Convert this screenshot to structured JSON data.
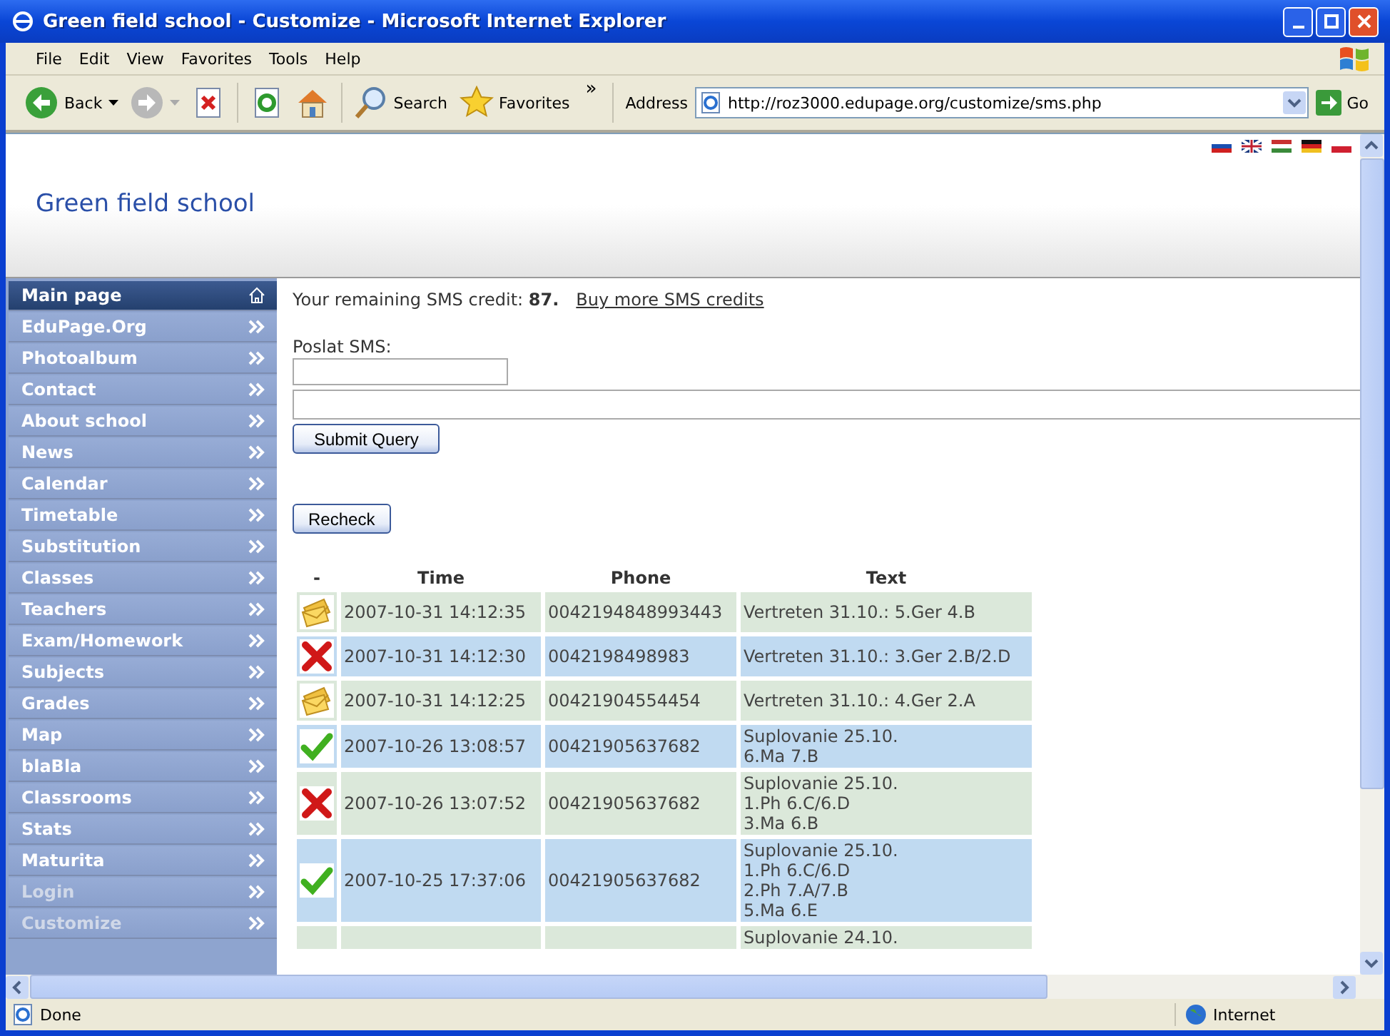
{
  "window": {
    "title": "Green field school - Customize - Microsoft Internet Explorer"
  },
  "menu_bar": [
    "File",
    "Edit",
    "View",
    "Favorites",
    "Tools",
    "Help"
  ],
  "toolbar": [
    {
      "kind": "back",
      "label": "Back"
    },
    {
      "kind": "forward"
    },
    {
      "kind": "stop"
    },
    {
      "kind": "refresh"
    },
    {
      "kind": "home"
    },
    {
      "kind": "search",
      "label": "Search"
    },
    {
      "kind": "favorites",
      "label": "Favorites"
    }
  ],
  "overflow": "»",
  "address": {
    "label": "Address",
    "value": "http://roz3000.edupage.org/customize/sms.php",
    "go": "Go"
  },
  "site": {
    "title": "Green field school"
  },
  "sidebar": {
    "items": [
      {
        "label": "Main page",
        "kind": "home",
        "selected": true,
        "disabled": false
      },
      {
        "label": "EduPage.Org",
        "kind": "link",
        "selected": false,
        "disabled": false
      },
      {
        "label": "Photoalbum",
        "kind": "link",
        "selected": false,
        "disabled": false
      },
      {
        "label": "Contact",
        "kind": "link",
        "selected": false,
        "disabled": false
      },
      {
        "label": "About school",
        "kind": "link",
        "selected": false,
        "disabled": false
      },
      {
        "label": "News",
        "kind": "link",
        "selected": false,
        "disabled": false
      },
      {
        "label": "Calendar",
        "kind": "link",
        "selected": false,
        "disabled": false
      },
      {
        "label": "Timetable",
        "kind": "link",
        "selected": false,
        "disabled": false
      },
      {
        "label": "Substitution",
        "kind": "link",
        "selected": false,
        "disabled": false
      },
      {
        "label": "Classes",
        "kind": "link",
        "selected": false,
        "disabled": false
      },
      {
        "label": "Teachers",
        "kind": "link",
        "selected": false,
        "disabled": false
      },
      {
        "label": "Exam/Homework",
        "kind": "link",
        "selected": false,
        "disabled": false
      },
      {
        "label": "Subjects",
        "kind": "link",
        "selected": false,
        "disabled": false
      },
      {
        "label": "Grades",
        "kind": "link",
        "selected": false,
        "disabled": false
      },
      {
        "label": "Map",
        "kind": "link",
        "selected": false,
        "disabled": false
      },
      {
        "label": "blaBla",
        "kind": "link",
        "selected": false,
        "disabled": false
      },
      {
        "label": "Classrooms",
        "kind": "link",
        "selected": false,
        "disabled": false
      },
      {
        "label": "Stats",
        "kind": "link",
        "selected": false,
        "disabled": false
      },
      {
        "label": "Maturita",
        "kind": "link",
        "selected": false,
        "disabled": false
      },
      {
        "label": "Login",
        "kind": "link",
        "selected": false,
        "disabled": true
      },
      {
        "label": "Customize",
        "kind": "link",
        "selected": false,
        "disabled": true
      }
    ]
  },
  "credit": {
    "text": "Your remaining SMS credit: **87.**",
    "link": "Buy more SMS credits"
  },
  "form": {
    "label": "Poslat SMS:",
    "submit": "Submit Query",
    "recheck": "Recheck"
  },
  "table": {
    "columns": [
      "-",
      "Time",
      "Phone",
      "Text"
    ],
    "rows": [
      {
        "kind": "pending",
        "time": "2007-10-31 14:12:35",
        "phone": "0042194848993443",
        "text": [
          "Vertreten 31.10.: 5.Ger 4.B"
        ]
      },
      {
        "kind": "failed",
        "time": "2007-10-31 14:12:30",
        "phone": "0042198498983",
        "text": [
          "Vertreten 31.10.: 3.Ger 2.B/2.D"
        ]
      },
      {
        "kind": "pending",
        "time": "2007-10-31 14:12:25",
        "phone": "00421904554454",
        "text": [
          "Vertreten 31.10.: 4.Ger 2.A"
        ]
      },
      {
        "kind": "sent",
        "time": "2007-10-26 13:08:57",
        "phone": "00421905637682",
        "text": [
          "Suplovanie 25.10.",
          "6.Ma 7.B"
        ]
      },
      {
        "kind": "failed",
        "time": "2007-10-26 13:07:52",
        "phone": "00421905637682",
        "text": [
          "Suplovanie 25.10.",
          "1.Ph 6.C/6.D",
          "3.Ma 6.B"
        ]
      },
      {
        "kind": "sent",
        "time": "2007-10-25 17:37:06",
        "phone": "00421905637682",
        "text": [
          "Suplovanie 25.10.",
          "1.Ph 6.C/6.D",
          "2.Ph 7.A/7.B",
          "5.Ma 6.E"
        ]
      },
      {
        "text": [
          "Suplovanie 24.10."
        ]
      }
    ]
  },
  "status_bar": {
    "text": "Done",
    "zone": "Internet"
  }
}
